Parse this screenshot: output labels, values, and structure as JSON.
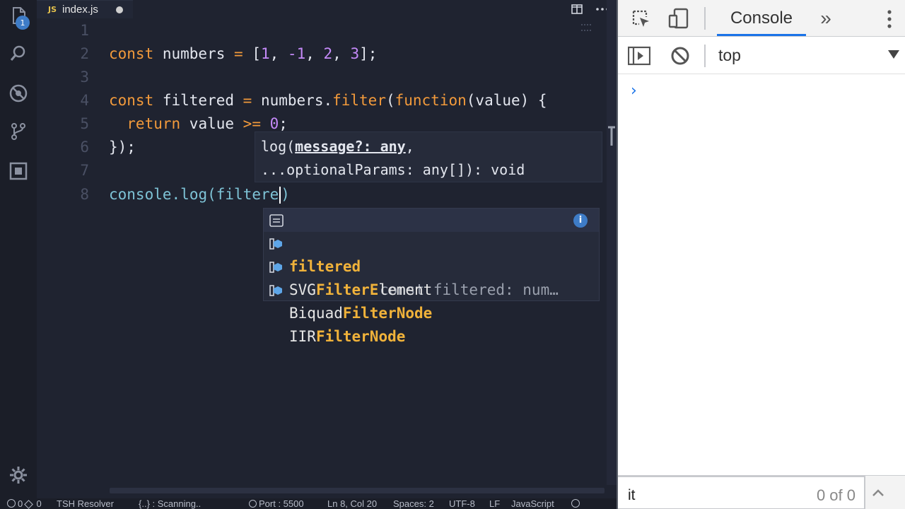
{
  "activity_bar": {
    "icons": [
      "files-icon",
      "search-icon",
      "debug-icon",
      "source-control-icon",
      "extensions-icon",
      "settings-gear-icon"
    ],
    "badge": "1"
  },
  "tab": {
    "icon_text": "JS",
    "filename": "index.js"
  },
  "editor": {
    "line_numbers": [
      "1",
      "2",
      "3",
      "4",
      "5",
      "6",
      "7",
      "8"
    ],
    "lines": {
      "l2": {
        "kw": "const",
        "name": " numbers ",
        "eq": "=",
        "sp": " [",
        "n1": "1",
        "c1": ", ",
        "n2": "-1",
        "c2": ", ",
        "n3": "2",
        "c3": ", ",
        "n4": "3",
        "end": "];"
      },
      "l4": {
        "kw": "const",
        "name": " filtered ",
        "eq": "=",
        "obj": " numbers.",
        "fn": "filter",
        "p1": "(",
        "kw2": "function",
        "p2": "(value) {"
      },
      "l5": {
        "kw": "  return",
        "rest": " value ",
        "op": ">=",
        "sp": " ",
        "num": "0",
        "end": ";"
      },
      "l6": {
        "text": "});"
      },
      "l8": {
        "obj": "console",
        "dot": ".",
        "fn": "log",
        "open": "(",
        "arg": "filtere",
        "close": ")"
      }
    }
  },
  "param_hint": {
    "row1_pre": "log(",
    "row1_param": "message?: any",
    "row1_post": ",",
    "row2": "...optionalParams: any[]): void"
  },
  "suggestions": [
    {
      "match": "filtere",
      "rest": "d",
      "detail": "const filtered: num…",
      "kind": "variable"
    },
    {
      "pre": "SVG",
      "match": "FilterE",
      "rest": "lement",
      "kind": "class"
    },
    {
      "pre": "Biquad",
      "match": "Filter",
      "rest": "Node",
      "kind": "class"
    },
    {
      "pre": "IIR",
      "match": "Filter",
      "rest": "Node",
      "kind": "class"
    }
  ],
  "suggest_info": "i",
  "status_bar": {
    "errors": "0",
    "warnings": "0",
    "resolver": "TSH Resolver",
    "scanning": "{..} : Scanning..",
    "port": "Port : 5500",
    "position": "Ln 8, Col 20",
    "spaces": "Spaces: 2",
    "encoding": "UTF-8",
    "eol": "LF",
    "language": "JavaScript"
  },
  "devtools": {
    "active_tab": "Console",
    "more": "»",
    "context": "top",
    "prompt": "›",
    "find_text": "it",
    "find_count": "0 of 0"
  }
}
